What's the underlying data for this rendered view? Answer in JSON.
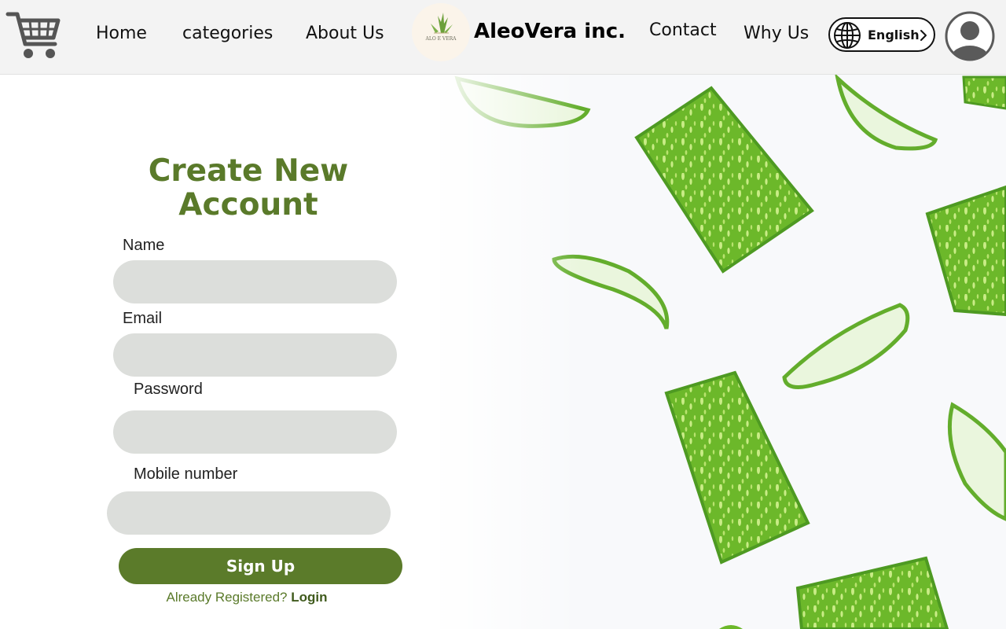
{
  "nav": {
    "home": "Home",
    "categories": "categories",
    "about": "About Us",
    "brand_name": "AleoVera inc.",
    "logo_text": "ALO E VERA",
    "contact": "Contact",
    "why": "Why Us",
    "language": "English"
  },
  "form": {
    "title": "Create New Account",
    "fields": [
      {
        "label": "Name",
        "value": ""
      },
      {
        "label": "Email",
        "value": ""
      },
      {
        "label": "Password",
        "value": ""
      },
      {
        "label": "Mobile number",
        "value": ""
      }
    ],
    "submit_label": "Sign Up",
    "already_registered": "Already Registered?",
    "login_label": "Login"
  },
  "colors": {
    "accent": "#5b7b2a",
    "title": "#5a7a2a",
    "input_bg": "#dcdedb",
    "nav_bg": "#f3f3f3",
    "aloe_green": "#6cb82a",
    "aloe_spot": "#c9ec86"
  },
  "icons": {
    "cart": "shopping-cart-icon",
    "globe": "globe-icon",
    "chevron": "chevron-right-icon",
    "avatar": "user-avatar-icon",
    "logo": "aloe-leaf-logo"
  }
}
